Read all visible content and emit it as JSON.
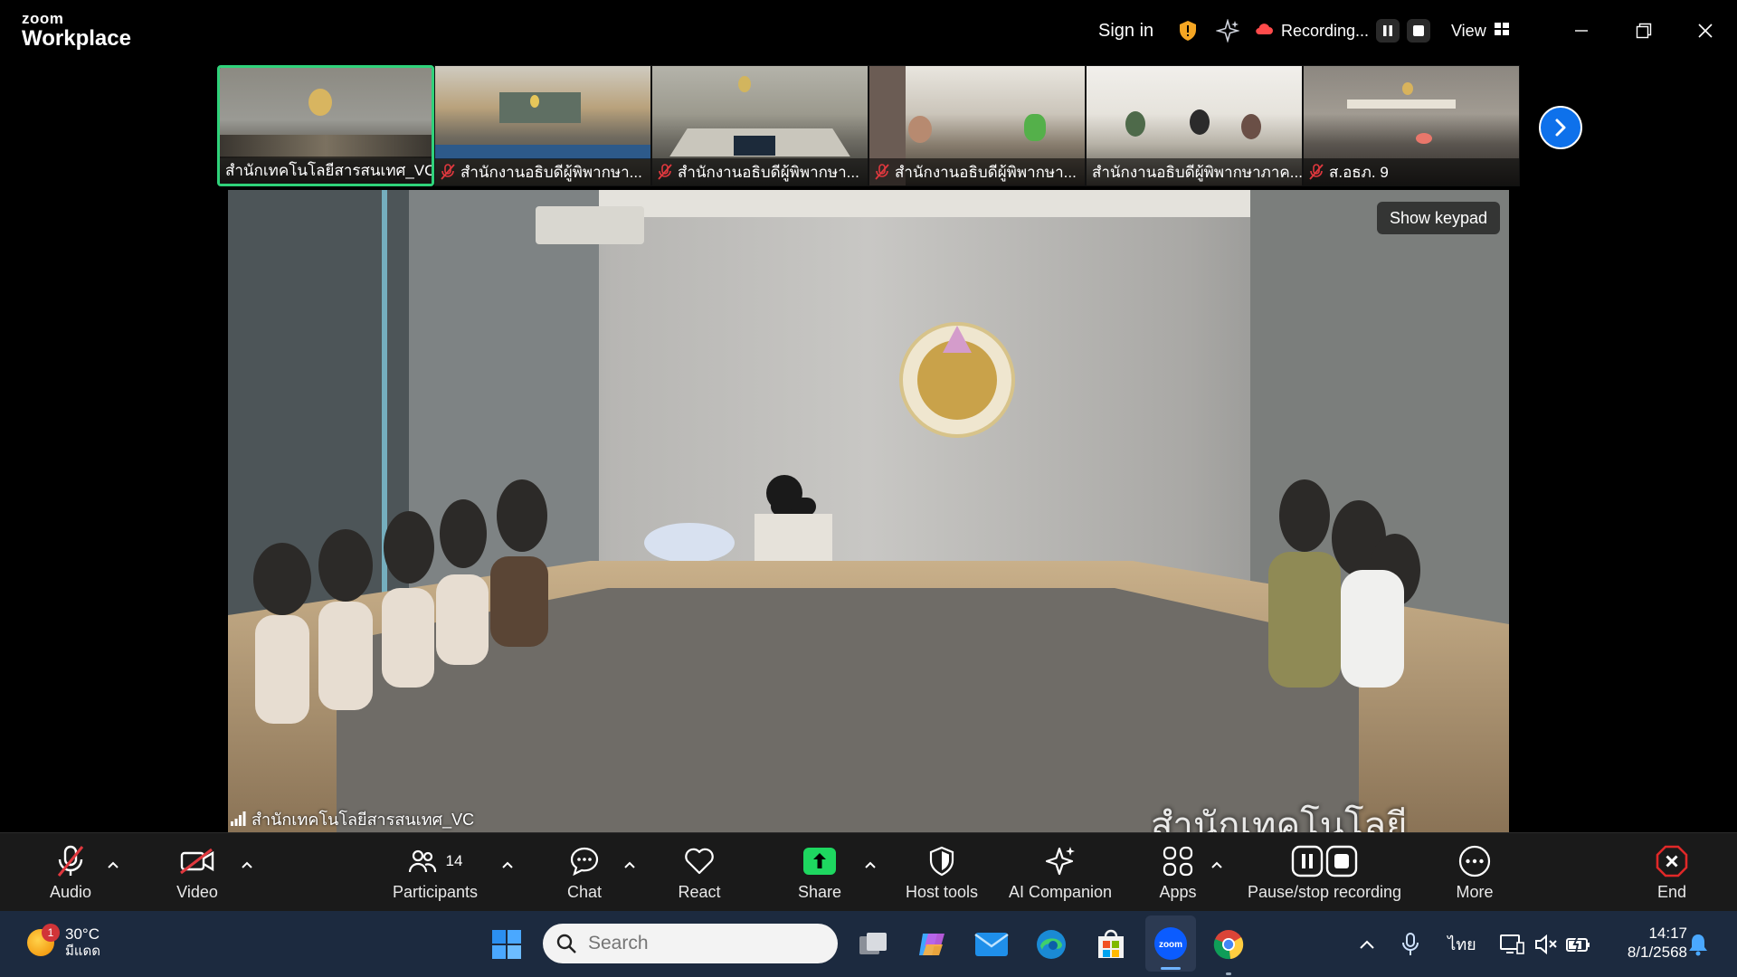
{
  "app": {
    "brand_top": "zoom",
    "brand_bottom": "Workplace",
    "sign_in": "Sign in",
    "recording_label": "Recording...",
    "view_label": "View"
  },
  "filmstrip": {
    "tiles": [
      {
        "name": "สำนักเทคโนโลยีสารสนเทศ_VC",
        "muted": false,
        "active": true
      },
      {
        "name": "สำนักงานอธิบดีผู้พิพากษา...",
        "muted": true,
        "active": false
      },
      {
        "name": "สำนักงานอธิบดีผู้พิพากษา...",
        "muted": true,
        "active": false
      },
      {
        "name": "สำนักงานอธิบดีผู้พิพากษา...",
        "muted": true,
        "active": false
      },
      {
        "name": "สำนักงานอธิบดีผู้พิพากษาภาค...",
        "muted": false,
        "active": false
      },
      {
        "name": "ส.อธภ. 9",
        "muted": true,
        "active": false
      }
    ]
  },
  "main_video": {
    "show_keypad": "Show keypad",
    "speaker_name": "สำนักเทคโนโลยีสารสนเทศ_VC",
    "caption_text": "สำนักเทคโนโลยี"
  },
  "toolbar": {
    "audio": "Audio",
    "video": "Video",
    "participants": "Participants",
    "participants_count": "14",
    "chat": "Chat",
    "react": "React",
    "share": "Share",
    "host_tools": "Host tools",
    "ai_companion": "AI Companion",
    "apps": "Apps",
    "pause_stop": "Pause/stop recording",
    "more": "More",
    "end": "End"
  },
  "taskbar": {
    "weather_temp": "30°C",
    "weather_cond": "มีแดด",
    "weather_badge": "1",
    "search_placeholder": "Search",
    "language": "ไทย",
    "time": "14:17",
    "date": "8/1/2568"
  },
  "colors": {
    "active_border": "#2fd27a",
    "accent_blue": "#0e71eb",
    "share_green": "#1ed760",
    "end_red": "#e02828",
    "mute_red": "#e0383e"
  }
}
